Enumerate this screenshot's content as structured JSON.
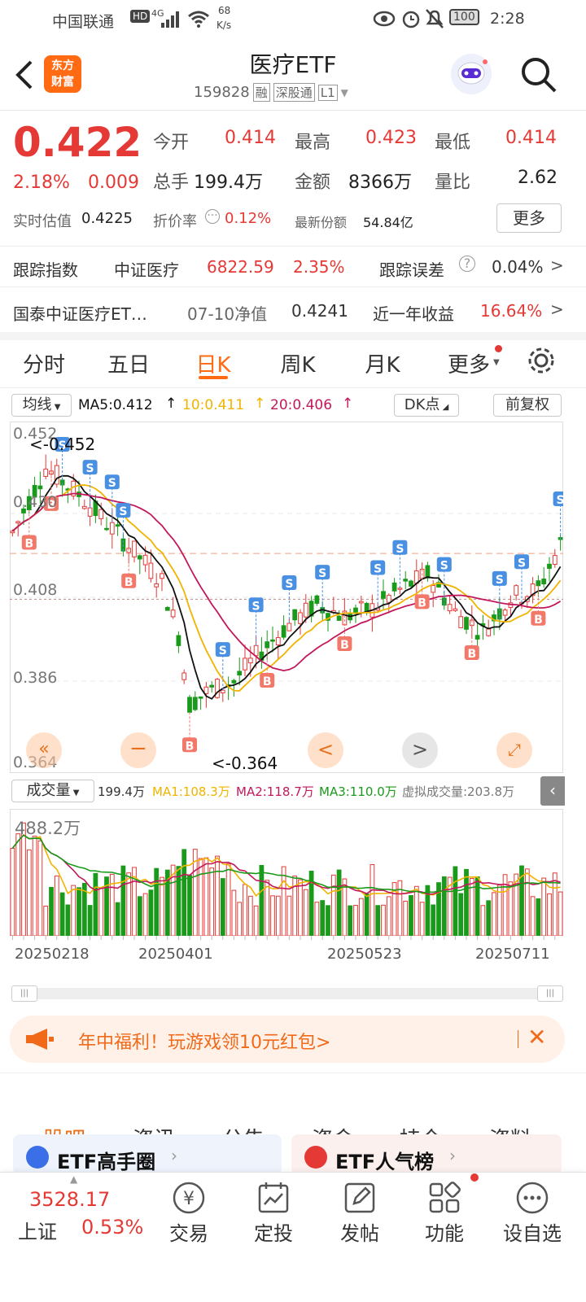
{
  "status_bar": {
    "carrier": "中国联通",
    "hd": "HD",
    "signal": "4G",
    "speed_value": "68",
    "speed_unit": "K/s",
    "battery": "100",
    "time": "2:28"
  },
  "header": {
    "title": "医疗ETF",
    "code": "159828",
    "tags": [
      "融",
      "深股通",
      "L1"
    ],
    "logo_line1": "东方",
    "logo_line2": "财富"
  },
  "quote": {
    "price": "0.422",
    "change_pct": "2.18%",
    "change": "0.009",
    "open_label": "今开",
    "open": "0.414",
    "high_label": "最高",
    "high": "0.423",
    "low_label": "最低",
    "low": "0.414",
    "volume_label": "总手",
    "volume": "199.4万",
    "amount_label": "金额",
    "amount": "8366万",
    "ratio_label": "量比",
    "ratio": "2.62",
    "iopv_label": "实时估值",
    "iopv": "0.4225",
    "discount_label": "折价率",
    "discount": "0.12%",
    "shares_label": "最新份额",
    "shares": "54.84亿",
    "more_button": "更多"
  },
  "tracking": {
    "index_label": "跟踪指数",
    "index_name": "中证医疗",
    "index_value": "6822.59",
    "index_change": "2.35%",
    "error_label": "跟踪误差",
    "error_value": "0.04%"
  },
  "fund": {
    "name": "国泰中证医疗ET…",
    "nav_label": "07-10净值",
    "nav": "0.4241",
    "return_label": "近一年收益",
    "return": "16.64%"
  },
  "chart_tabs": [
    "分时",
    "五日",
    "日K",
    "周K",
    "月K",
    "更多"
  ],
  "active_tab": "日K",
  "ma_bar": {
    "selector": "均线",
    "ma5": "MA5:0.412",
    "ma10": "10:0.411",
    "ma20": "20:0.406",
    "dk": "DK点",
    "adjust": "前复权"
  },
  "chart_data": {
    "type": "candlestick",
    "y_ticks": [
      "0.452",
      "0.430",
      "0.408",
      "0.386",
      "0.364"
    ],
    "ylim": [
      0.364,
      0.452
    ],
    "high_marker": "0.452",
    "low_marker": "0.364",
    "x_ticks": [
      "20250218",
      "20250401",
      "20250523",
      "20250711"
    ],
    "volume_max_label": "488.2万",
    "volume_bar": {
      "selector": "成交量",
      "current": "199.4万",
      "ma1": "MA1:108.3万",
      "ma2": "MA2:118.7万",
      "ma3": "MA3:110.0万",
      "virtual": "虚拟成交量:203.8万"
    },
    "colors": {
      "up": "#e53935",
      "down": "#1a9a1a",
      "ma5": "#111111",
      "ma10": "#f0b400",
      "ma20": "#c2185b"
    }
  },
  "banner": {
    "text": "年中福利！玩游戏领10元红包>"
  },
  "bottom_tabs": [
    "股吧",
    "资讯",
    "公告",
    "资金",
    "持仓",
    "资料"
  ],
  "active_bottom_tab": "股吧",
  "cards": [
    "ETF高手圈",
    "ETF人气榜"
  ],
  "bottom_nav": {
    "index_value": "3528.17",
    "index_name": "上证",
    "index_change": "0.53%",
    "items": [
      "交易",
      "定投",
      "发帖",
      "功能",
      "设自选"
    ]
  }
}
